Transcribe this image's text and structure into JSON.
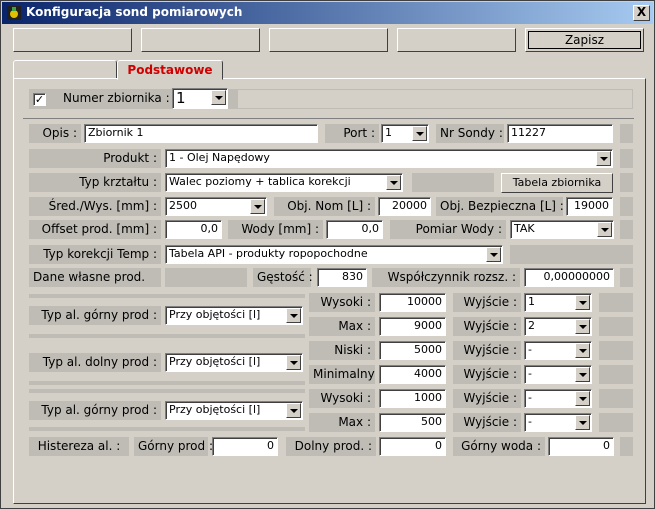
{
  "window": {
    "title": "Konfiguracja sond pomiarowych",
    "close_glyph": "X"
  },
  "toolbar": {
    "save_label": "Zapisz"
  },
  "tabs": [
    {
      "label": ""
    },
    {
      "label": "Podstawowe"
    }
  ],
  "tank": {
    "checked": true,
    "label": "Numer zbiornika :",
    "value": "1"
  },
  "opis": {
    "label": "Opis :",
    "value": "Zbiornik 1"
  },
  "port": {
    "label": "Port :",
    "value": "1"
  },
  "nr_sondy": {
    "label": "Nr Sondy :",
    "value": "11227"
  },
  "produkt": {
    "label": "Produkt :",
    "value": "1 - Olej Napędowy"
  },
  "typ_ksztaltu": {
    "label": "Typ krztałtu :",
    "value": "Walec poziomy + tablica korekcji",
    "button": "Tabela zbiornika"
  },
  "sred": {
    "label": "Śred./Wys. [mm] :",
    "value": "2500"
  },
  "obj_nom": {
    "label": "Obj. Nom [L] :",
    "value": "20000"
  },
  "obj_bezp": {
    "label": "Obj. Bezpieczna [L] :",
    "value": "19000"
  },
  "offset": {
    "label": "Offset prod. [mm] :",
    "value": "0,0"
  },
  "wody": {
    "label": "Wody [mm] :",
    "value": "0,0"
  },
  "pomiar_wody": {
    "label": "Pomiar Wody :",
    "value": "TAK"
  },
  "korekcja": {
    "label": "Typ korekcji Temp :",
    "value": "Tabela API - produkty ropopochodne"
  },
  "dane": {
    "label": "Dane własne prod.",
    "gestosc_label": "Gęstość :",
    "gestosc": "830",
    "wsp_label": "Współczynnik rozsz. :",
    "wsp": "0,00000000"
  },
  "alarm_groups": [
    {
      "type_label": "Typ al. górny prod :",
      "type_value": "Przy objętości [l]",
      "rows": [
        {
          "label": "Wysoki :",
          "value": "10000",
          "out_label": "Wyjście :",
          "out": "1"
        },
        {
          "label": "Max :",
          "value": "9000",
          "out_label": "Wyjście :",
          "out": "2"
        }
      ]
    },
    {
      "type_label": "Typ al. dolny prod :",
      "type_value": "Przy objętości [l]",
      "rows": [
        {
          "label": "Niski :",
          "value": "5000",
          "out_label": "Wyjście :",
          "out": "-"
        },
        {
          "label": "Minimalny :",
          "value": "4000",
          "out_label": "Wyjście :",
          "out": "-"
        }
      ]
    },
    {
      "type_label": "Typ al. górny prod :",
      "type_value": "Przy objętości [l]",
      "rows": [
        {
          "label": "Wysoki :",
          "value": "1000",
          "out_label": "Wyjście :",
          "out": "-"
        },
        {
          "label": "Max :",
          "value": "500",
          "out_label": "Wyjście :",
          "out": "-"
        }
      ]
    }
  ],
  "histereza": {
    "label": "Histereza al. :",
    "gorny_label": "Górny prod :",
    "gorny": "0",
    "dolny_label": "Dolny prod. :",
    "dolny": "0",
    "woda_label": "Górny woda :",
    "woda": "0"
  }
}
